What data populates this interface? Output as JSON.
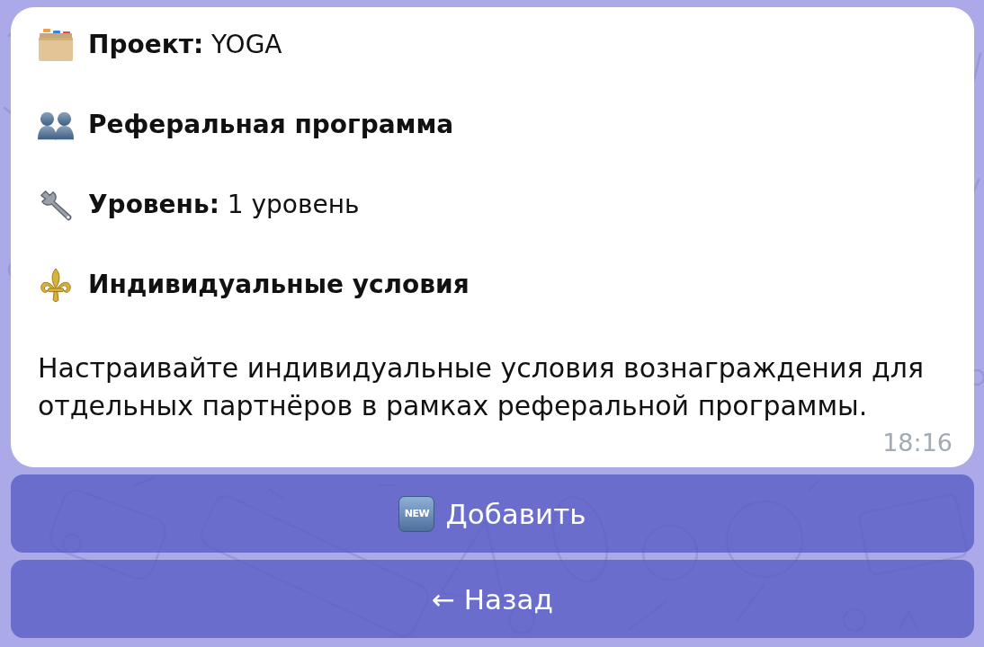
{
  "message": {
    "rows": [
      {
        "kind": "field",
        "text": "**Проект:** YOGA"
      },
      {
        "kind": "heading",
        "text": "Реферальная программа"
      },
      {
        "kind": "field",
        "text": "**Уровень:** 1 уровень"
      },
      {
        "kind": "heading",
        "text": "Индивидуальные условия"
      }
    ],
    "description": "Настраивайте индивидуальные условия вознаграждения для отдельных партнёров в рамках реферальной программы.",
    "time": "18:16"
  },
  "buttons": [
    {
      "badge": "NEW",
      "label": "Добавить"
    },
    {
      "label": "← Назад"
    }
  ]
}
